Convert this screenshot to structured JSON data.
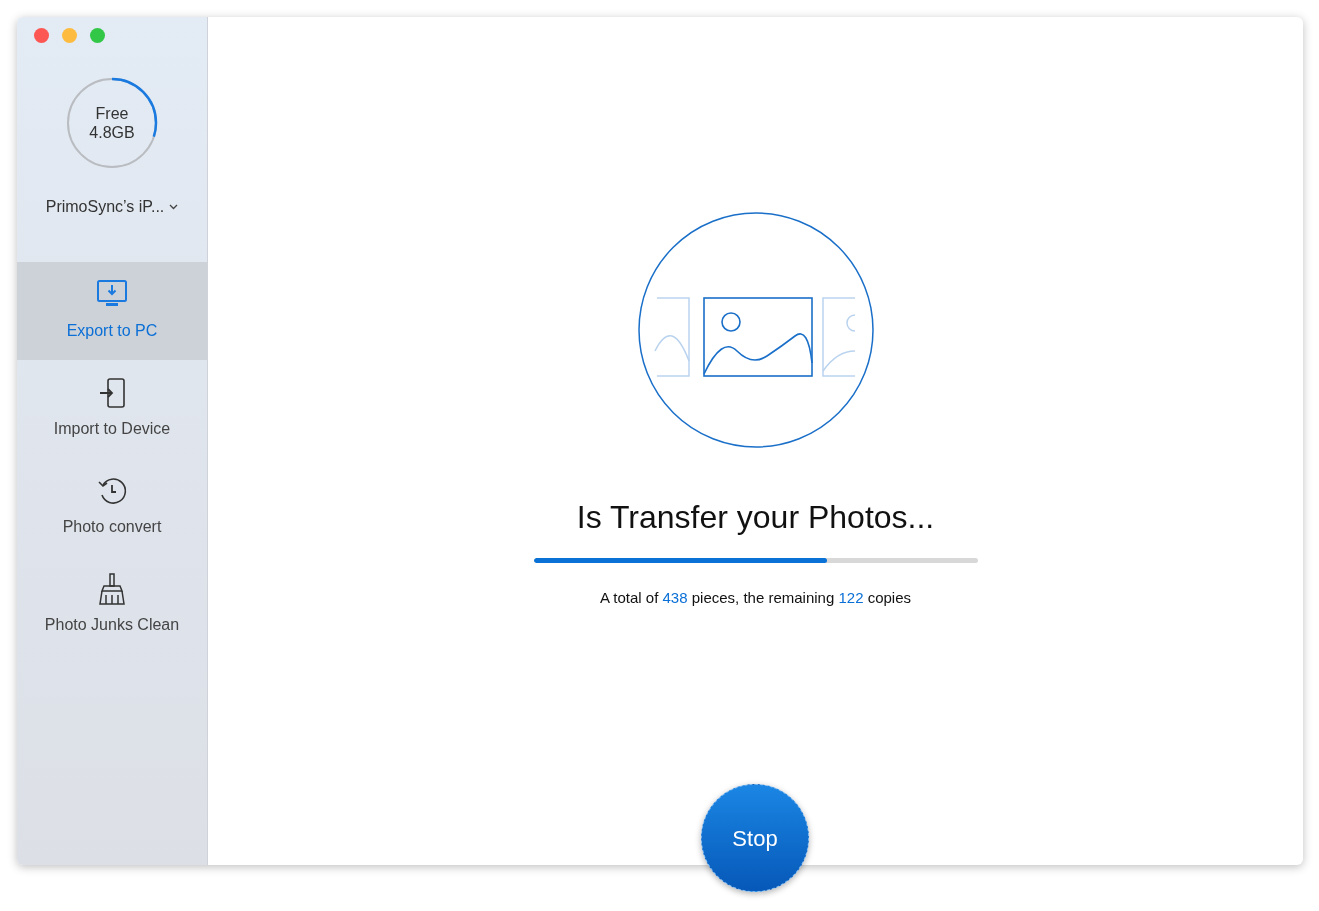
{
  "window": {
    "controls": [
      {
        "color": "#fc5753"
      },
      {
        "color": "#fdbc40"
      },
      {
        "color": "#33c748"
      }
    ]
  },
  "storage": {
    "label": "Free",
    "value": "4.8GB",
    "level": 0.3
  },
  "device": {
    "name": "PrimoSync’s iP..."
  },
  "nav": [
    {
      "kind": "export",
      "label": "Export to PC",
      "selected": true
    },
    {
      "kind": "import",
      "label": "Import to Device",
      "selected": false
    },
    {
      "kind": "convert",
      "label": "Photo convert",
      "selected": false
    },
    {
      "kind": "clean",
      "label": "Photo Junks Clean",
      "selected": false
    }
  ],
  "transfer": {
    "title": "Is Transfer your Photos...",
    "level": 0.66,
    "summary": [
      {
        "text": "A total of",
        "highlight": false
      },
      {
        "text": "438",
        "highlight": true
      },
      {
        "text": "pieces, the remaining",
        "highlight": false
      },
      {
        "text": "122",
        "highlight": true
      },
      {
        "text": "copies",
        "highlight": false
      }
    ]
  },
  "stop_button": {
    "label": "Stop"
  }
}
